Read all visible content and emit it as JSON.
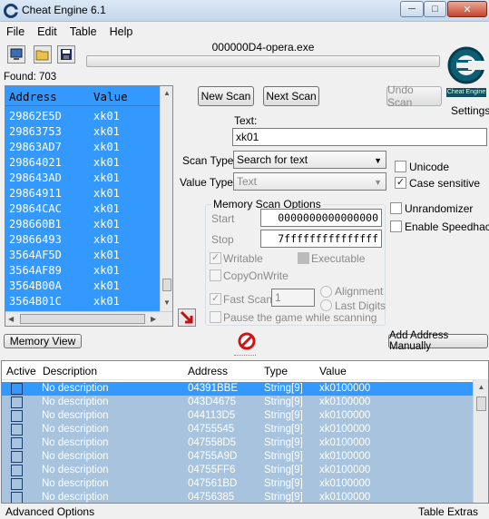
{
  "window": {
    "title": "Cheat Engine 6.1"
  },
  "menu": [
    "File",
    "Edit",
    "Table",
    "Help"
  ],
  "process": "000000D4-opera.exe",
  "found": "Found: 703",
  "results": {
    "col_address": "Address",
    "col_value": "Value",
    "rows": [
      {
        "address": "29862E5D",
        "value": "xk01"
      },
      {
        "address": "29863753",
        "value": "xk01"
      },
      {
        "address": "29863AD7",
        "value": "xk01"
      },
      {
        "address": "29864021",
        "value": "xk01"
      },
      {
        "address": "298643AD",
        "value": "xk01"
      },
      {
        "address": "29864911",
        "value": "xk01"
      },
      {
        "address": "29864CAC",
        "value": "xk01"
      },
      {
        "address": "298660B1",
        "value": "xk01"
      },
      {
        "address": "29866493",
        "value": "xk01"
      },
      {
        "address": "3564AF5D",
        "value": "xk01"
      },
      {
        "address": "3564AF89",
        "value": "xk01"
      },
      {
        "address": "3564B00A",
        "value": "xk01"
      },
      {
        "address": "3564B01C",
        "value": "xk01"
      }
    ]
  },
  "scan": {
    "new_scan": "New Scan",
    "next_scan": "Next Scan",
    "undo_scan": "Undo Scan",
    "settings": "Settings",
    "logo_caption": "Cheat Engine",
    "text_label": "Text:",
    "text_value": "xk01",
    "scan_type_label": "Scan Type",
    "scan_type_value": "Search for text",
    "value_type_label": "Value Type",
    "value_type_value": "Text",
    "unicode": "Unicode",
    "case_sensitive": "Case sensitive",
    "unrandomizer": "Unrandomizer",
    "speedhack": "Enable Speedhack"
  },
  "memory_options": {
    "title": "Memory Scan Options",
    "start_label": "Start",
    "start_value": "0000000000000000",
    "stop_label": "Stop",
    "stop_value": "7fffffffffffffff",
    "writable": "Writable",
    "executable": "Executable",
    "copy_on_write": "CopyOnWrite",
    "fast_scan": "Fast Scan",
    "fast_scan_value": "1",
    "alignment": "Alignment",
    "last_digits": "Last Digits",
    "pause": "Pause the game while scanning"
  },
  "buttons": {
    "memory_view": "Memory View",
    "add_address": "Add Address Manually"
  },
  "table": {
    "col_active": "Active",
    "col_description": "Description",
    "col_address": "Address",
    "col_type": "Type",
    "col_value": "Value",
    "rows": [
      {
        "description": "No description",
        "address": "04391BBE",
        "type": "String[9]",
        "value": "xk0100000"
      },
      {
        "description": "No description",
        "address": "043D4675",
        "type": "String[9]",
        "value": "xk0100000"
      },
      {
        "description": "No description",
        "address": "044113D5",
        "type": "String[9]",
        "value": "xk0100000"
      },
      {
        "description": "No description",
        "address": "04755545",
        "type": "String[9]",
        "value": "xk0100000"
      },
      {
        "description": "No description",
        "address": "047558D5",
        "type": "String[9]",
        "value": "xk0100000"
      },
      {
        "description": "No description",
        "address": "04755A9D",
        "type": "String[9]",
        "value": "xk0100000"
      },
      {
        "description": "No description",
        "address": "04755FF6",
        "type": "String[9]",
        "value": "xk0100000"
      },
      {
        "description": "No description",
        "address": "047561BD",
        "type": "String[9]",
        "value": "xk0100000"
      },
      {
        "description": "No description",
        "address": "04756385",
        "type": "String[9]",
        "value": "xk0100000"
      }
    ]
  },
  "status": {
    "advanced": "Advanced Options",
    "extras": "Table Extras"
  },
  "colors": {
    "selection": "#3399ff",
    "table_selection_first": "#3399ff",
    "table_selection": "#a8c3de"
  }
}
